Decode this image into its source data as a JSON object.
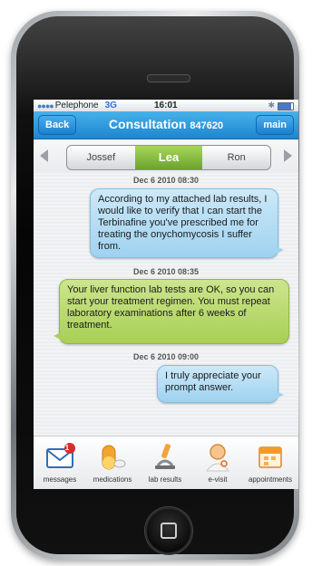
{
  "status_bar": {
    "signal": "●●●●",
    "carrier": "Pelephone",
    "network": "3G",
    "time": "16:01",
    "bluetooth_icon": "bluetooth-icon",
    "battery_level": 0.9
  },
  "nav": {
    "back_label": "Back",
    "title": "Consultation",
    "consultation_id": "847620",
    "main_label": "main"
  },
  "tabs": [
    {
      "label": "Jossef",
      "active": false
    },
    {
      "label": "Lea",
      "active": true
    },
    {
      "label": "Ron",
      "active": false
    }
  ],
  "messages": [
    {
      "date": "Dec 6 2010 08:30",
      "text": "According to my attached lab results, I would like to verify that I can start the Terbinafine you've prescribed me for treating the onychomycosis I suffer from.",
      "side": "right"
    },
    {
      "date": "Dec 6 2010 08:35",
      "text": "Your liver function lab tests are OK, so you can start your treatment regimen. You must repeat laboratory examinations after 6 weeks of treatment.",
      "side": "left"
    },
    {
      "date": "Dec 6 2010 09:00",
      "text": "I truly appreciate your prompt answer.",
      "side": "right"
    }
  ],
  "bottom_nav": [
    {
      "label": "messages",
      "icon": "envelope-icon",
      "badge": "1"
    },
    {
      "label": "medications",
      "icon": "pill-icon"
    },
    {
      "label": "lab results",
      "icon": "microscope-icon"
    },
    {
      "label": "e-visit",
      "icon": "doctor-icon"
    },
    {
      "label": "appointments",
      "icon": "calendar-icon"
    }
  ],
  "colors": {
    "nav_blue": "#1f85d0",
    "active_tab_green": "#6aa32c",
    "patient_bubble": "#9fd2f0",
    "doctor_bubble": "#a8cf55",
    "badge_red": "#d92c2c"
  }
}
